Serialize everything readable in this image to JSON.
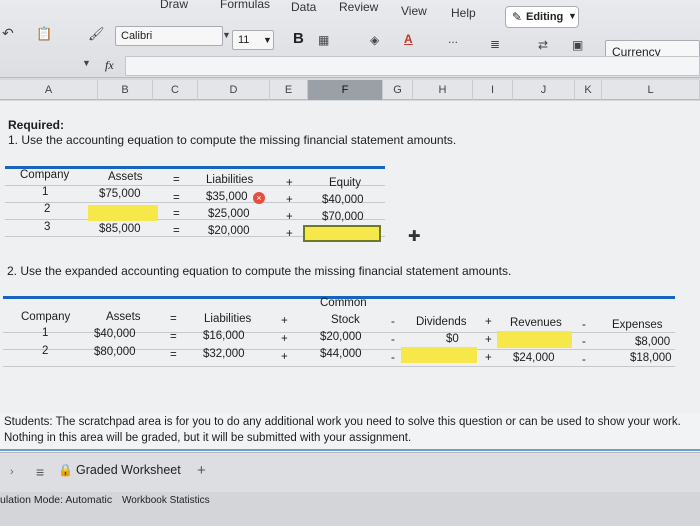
{
  "ribbon": {
    "menus": [
      "Draw",
      "Formulas",
      "Data",
      "Review",
      "View",
      "Help"
    ],
    "editing_label": "Editing",
    "font_name": "Calibri",
    "font_size": "11",
    "bold_label": "B",
    "number_format": "Currency",
    "formula_label": "fx",
    "more_label": "..."
  },
  "columns": [
    "A",
    "B",
    "C",
    "D",
    "E",
    "F",
    "G",
    "H",
    "I",
    "J",
    "K",
    "L"
  ],
  "sheet": {
    "required": "Required:",
    "q1": "1. Use the accounting equation to compute the missing financial statement amounts.",
    "q2": "2. Use the expanded accounting equation to compute the missing financial statement amounts.",
    "table1": {
      "headers": [
        "Company",
        "Assets",
        "=",
        "Liabilities",
        "+",
        "Equity"
      ],
      "rows": [
        [
          "1",
          "$75,000",
          "=",
          "$35,000",
          "+",
          "$40,000"
        ],
        [
          "2",
          "",
          "=",
          "$25,000",
          "+",
          "$70,000"
        ],
        [
          "3",
          "$85,000",
          "=",
          "$20,000",
          "+",
          ""
        ]
      ]
    },
    "table2": {
      "headers": [
        "Company",
        "Assets",
        "=",
        "Liabilities",
        "+",
        "Common",
        "Stock",
        "-",
        "Dividends",
        "+",
        "Revenues",
        "-",
        "Expenses"
      ],
      "rows": [
        [
          "1",
          "$40,000",
          "=",
          "$16,000",
          "+",
          "$20,000",
          "-",
          "$0",
          "+",
          "",
          "-",
          "$8,000"
        ],
        [
          "2",
          "$80,000",
          "=",
          "$32,000",
          "+",
          "$44,000",
          "-",
          "",
          "+",
          "$24,000",
          "-",
          "$18,000"
        ]
      ]
    },
    "scratch": [
      "Students: The scratchpad area is for you to do any additional work you need to solve this question or can be used to show your work.",
      "Nothing in this area will be graded, but it will be submitted with your assignment."
    ]
  },
  "tabs": {
    "sheet_name": "Graded Worksheet",
    "add_label": "+"
  },
  "status": {
    "calc_mode": "ulation Mode: Automatic",
    "stats": "Workbook Statistics"
  },
  "colors": {
    "header_blue": "#1565c0",
    "highlight": "#f6e84a",
    "error": "#e74c3c"
  }
}
